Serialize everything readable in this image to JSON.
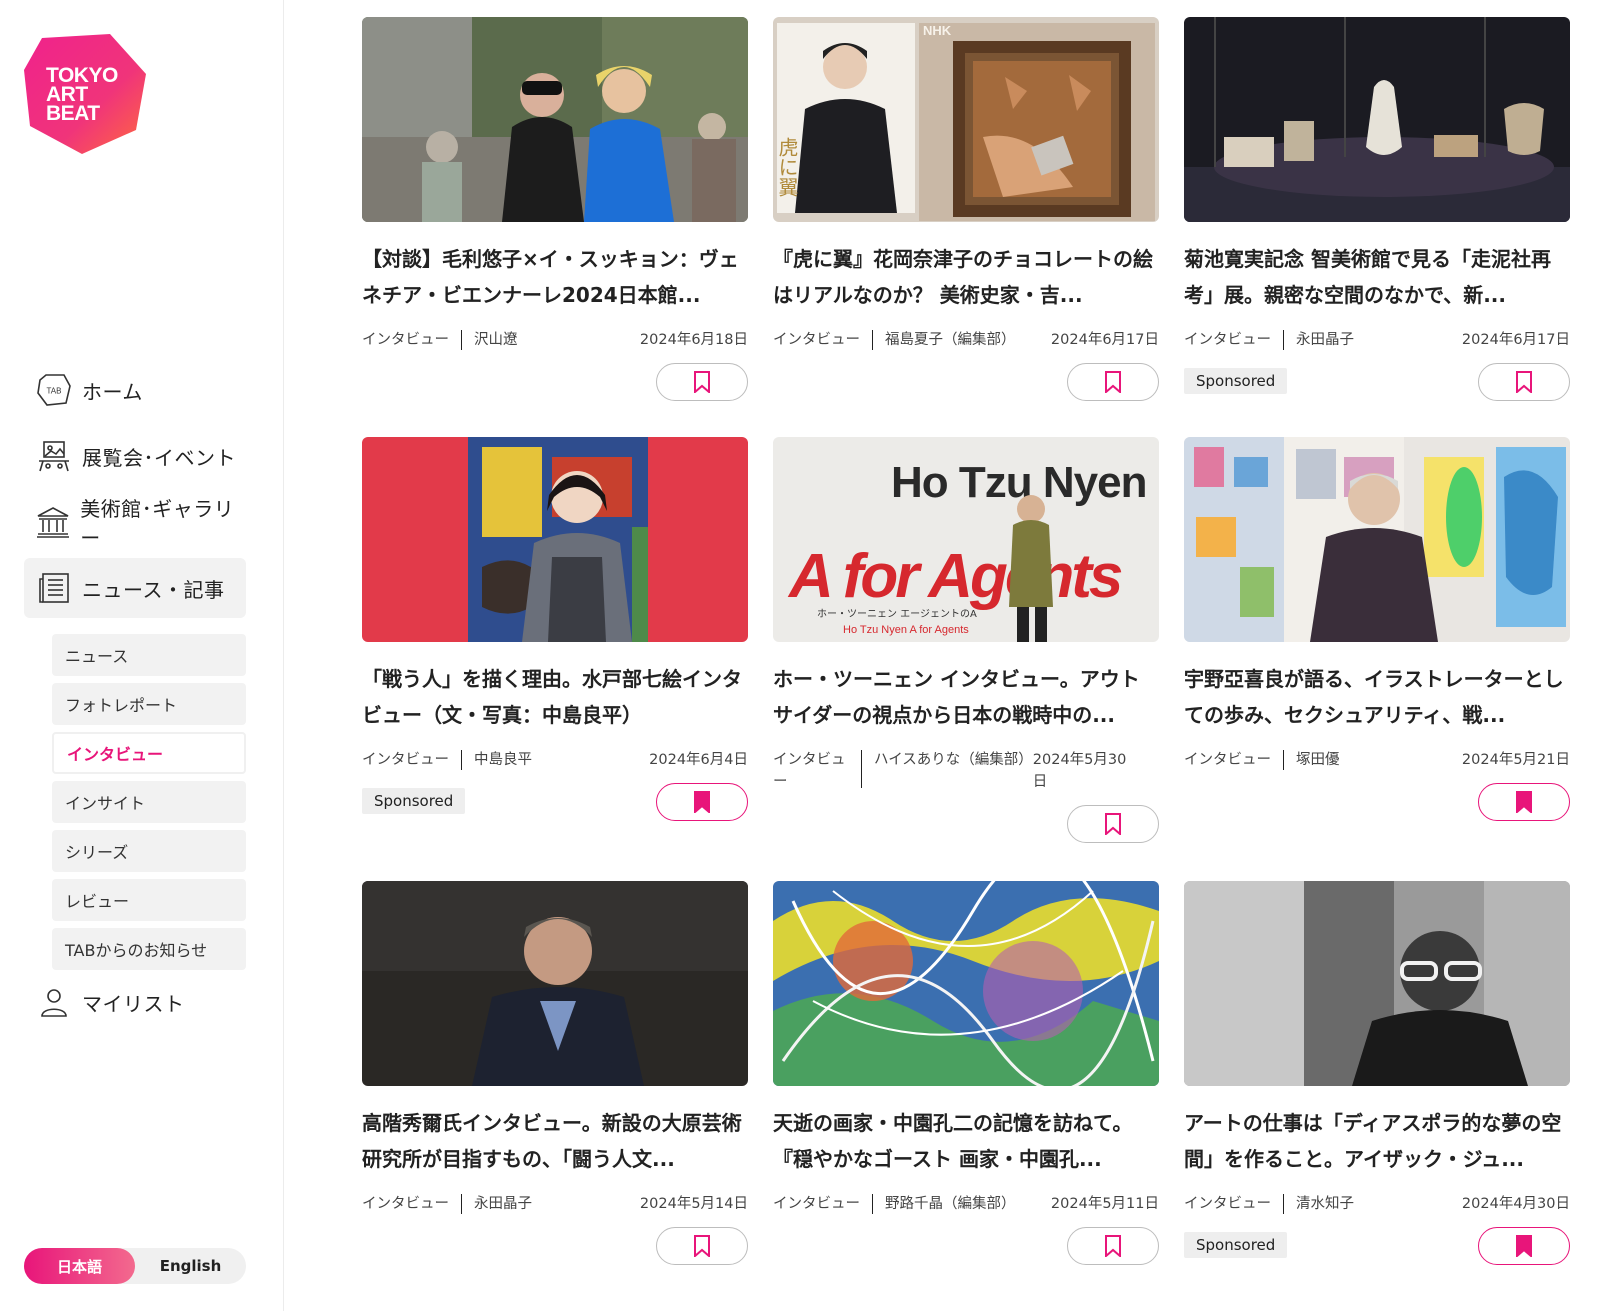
{
  "logo": {
    "lines": [
      "TOKYO",
      "ART",
      "BEAT"
    ]
  },
  "nav": {
    "home": "ホーム",
    "exhibitions": "展覧会･イベント",
    "museums": "美術館･ギャラリー",
    "news": "ニュース・記事",
    "mylist": "マイリスト",
    "tab_badge": "TAB"
  },
  "subnav": [
    "ニュース",
    "フォトレポート",
    "インタビュー",
    "インサイト",
    "シリーズ",
    "レビュー",
    "TABからのお知らせ"
  ],
  "lang": {
    "ja": "日本語",
    "en": "English"
  },
  "colors": {
    "accent": "#e8157a",
    "logo_gradient": [
      "#f0228c",
      "#ff6a3d"
    ]
  },
  "cards": [
    {
      "title": "【対談】毛利悠子×イ・スッキョン：ヴェネチア・ビエンナーレ2024日本館...",
      "category": "インタビュー",
      "author": "沢山遼",
      "date": "2024年6月18日",
      "sponsored": "",
      "bookmarked": false,
      "image": "two-women-crowd-photo"
    },
    {
      "title": "『虎に翼』花岡奈津子のチョコレートの絵はリアルなのか？ 美術史家・吉...",
      "category": "インタビュー",
      "author": "福島夏子（編集部）",
      "date": "2024年6月17日",
      "sponsored": "",
      "bookmarked": false,
      "image": "poster-and-painting",
      "image_text_1": "虎に翼",
      "image_text_2": "NHK"
    },
    {
      "title": "菊池寛実記念 智美術館で見る「走泥社再考」展。親密な空間のなかで、新...",
      "category": "インタビュー",
      "author": "永田晶子",
      "date": "2024年6月17日",
      "sponsored": "Sponsored",
      "bookmarked": false,
      "image": "ceramics-gallery"
    },
    {
      "title": "「戦う人」を描く理由。水戸部七絵インタビュー（文・写真：中島良平）",
      "category": "インタビュー",
      "author": "中島良平",
      "date": "2024年6月4日",
      "sponsored": "Sponsored",
      "bookmarked": true,
      "image": "artist-red-wall"
    },
    {
      "title": "ホー・ツーニェン インタビュー。アウトサイダーの視点から日本の戦時中の...",
      "category": "インタビュー",
      "author": "ハイスありな（編集部）",
      "date": "2024年5月30日",
      "sponsored": "",
      "bookmarked": false,
      "image": "exhibition-wall-text",
      "image_text_1": "Ho Tzu Nyen",
      "image_text_2": "A for Agents",
      "image_text_3": "ホー・ツーニェン エージェントのA",
      "image_text_4": "Ho Tzu Nyen  A for Agents"
    },
    {
      "title": "宇野亞喜良が語る、イラストレーターとしての歩み、セクシュアリティ、戦...",
      "category": "インタビュー",
      "author": "塚田優",
      "date": "2024年5月21日",
      "sponsored": "",
      "bookmarked": true,
      "image": "illustrator-gallery"
    },
    {
      "title": "高階秀爾氏インタビュー。新設の大原芸術研究所が目指すもの、「闘う人文...",
      "category": "インタビュー",
      "author": "永田晶子",
      "date": "2024年5月14日",
      "sponsored": "",
      "bookmarked": false,
      "image": "elderly-man-portrait"
    },
    {
      "title": "天逝の画家・中園孔二の記憶を訪ねて。『穏やかなゴースト 画家・中園孔...",
      "category": "インタビュー",
      "author": "野路千晶（編集部）",
      "date": "2024年5月11日",
      "sponsored": "",
      "bookmarked": false,
      "image": "abstract-colorful-painting"
    },
    {
      "title": "アートの仕事は「ディアスポラ的な夢の空間」を作ること。アイザック・ジュ...",
      "category": "インタビュー",
      "author": "清水知子",
      "date": "2024年4月30日",
      "sponsored": "Sponsored",
      "bookmarked": true,
      "image": "man-glasses-bw"
    }
  ]
}
